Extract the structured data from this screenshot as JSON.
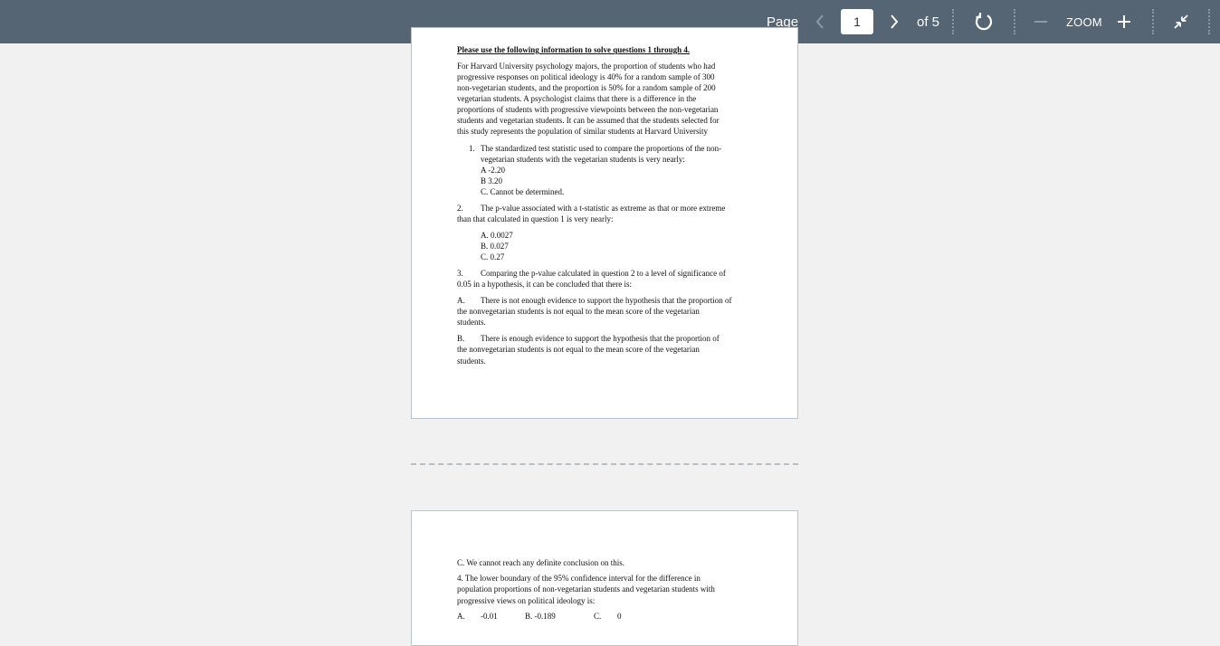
{
  "toolbar": {
    "page_label": "Page",
    "current_page": "1",
    "of_label": "of 5",
    "zoom_label": "ZOOM",
    "icons": {
      "prev": "chevron-left-icon",
      "next": "chevron-right-icon",
      "rotate": "rotate-icon",
      "zoom_out": "minus-icon",
      "zoom_in": "plus-icon",
      "collapse": "collapse-icon"
    }
  },
  "page1": {
    "heading": "Please use the following information to solve questions 1 through 4.",
    "intro": [
      "For Harvard University psychology majors, the proportion of students who had",
      "progressive responses on political ideology is 40% for a random sample of 300",
      "non-vegetarian students, and the proportion is 50% for a random sample of 200",
      "vegetarian students.  A psychologist claims that there is a difference in the",
      "proportions of students with progressive viewpoints between the non-vegetarian",
      "students and vegetarian students. It can be assumed that the students selected for",
      "this study represents the population of similar students at Harvard University"
    ],
    "q1": {
      "number": "1.",
      "lines": [
        "The standardized test statistic used to compare the proportions of the non-",
        "vegetarian students with the vegetarian students is very nearly:"
      ],
      "options": [
        "A  -2.20",
        "B  3.20",
        "C.  Cannot be determined."
      ]
    },
    "q2": {
      "number": "2.",
      "lines": [
        "The p-value associated with a t-statistic as extreme as that or more extreme",
        "than that calculated in question 1 is very nearly:"
      ],
      "options": [
        "A. 0.0027",
        "B. 0.027",
        "C. 0.27"
      ]
    },
    "q3": {
      "number": "3.",
      "lines": [
        "Comparing the p-value calculated in question 2 to a level of significance of",
        "0.05 in a hypothesis, it can be concluded that there is:"
      ],
      "options": [
        {
          "letter": "A.",
          "lines": [
            "There is not enough evidence to support the hypothesis that the proportion of",
            "the nonvegetarian students is not equal to the mean score of the vegetarian",
            "students."
          ]
        },
        {
          "letter": "B.",
          "lines": [
            "There is enough evidence to support the hypothesis that the proportion  of",
            "the nonvegetarian students is not equal to the mean score of the vegetarian",
            "students."
          ]
        }
      ]
    }
  },
  "page2": {
    "q3_option_c": "C. We cannot reach any definite conclusion on this.",
    "q4": {
      "lines": [
        "4.  The lower boundary of the 95% confidence interval for the difference in",
        "population proportions of non-vegetarian students and vegetarian students with",
        "progressive views on political ideology is:"
      ],
      "options": [
        {
          "letter": "A.",
          "value": "-0.01"
        },
        {
          "letter": "B.",
          "value": "B. -0.189"
        },
        {
          "letter": "C.",
          "value": "0"
        }
      ]
    }
  }
}
